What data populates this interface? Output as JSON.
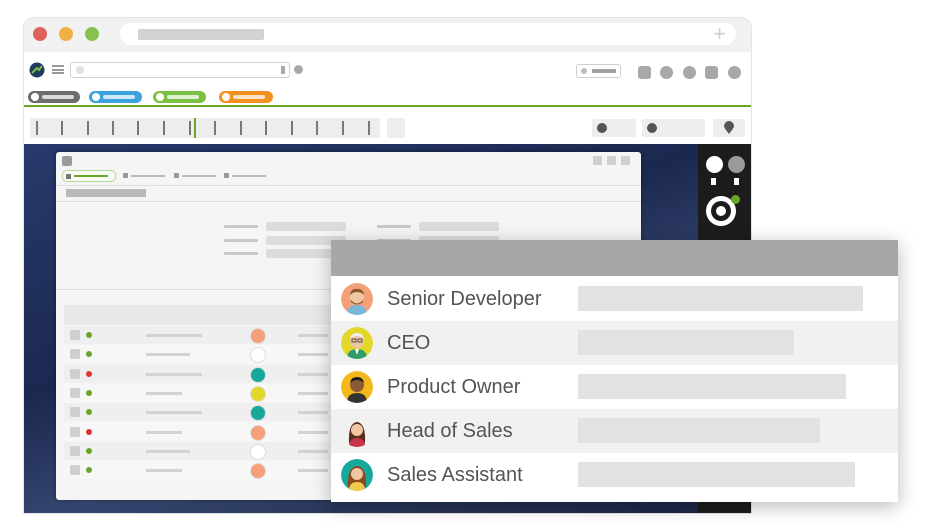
{
  "window": {
    "traffic_lights": [
      {
        "name": "close",
        "color": "#e0615c"
      },
      {
        "name": "minimize",
        "color": "#eeb144"
      },
      {
        "name": "maximize",
        "color": "#87c250"
      }
    ],
    "new_tab_symbol": "+"
  },
  "toolbar": {
    "filter_pills": [
      {
        "color": "#6d6d6d"
      },
      {
        "color": "#3aa2dc"
      },
      {
        "color": "#7ac143"
      },
      {
        "color": "#f5901e"
      }
    ],
    "accent_color": "#6aa626"
  },
  "list": {
    "rows": [
      {
        "status_color": "#6aa626"
      },
      {
        "status_color": "#6aa626"
      },
      {
        "status_color": "#e0322e"
      },
      {
        "status_color": "#6aa626"
      },
      {
        "status_color": "#6aa626"
      },
      {
        "status_color": "#e0322e"
      },
      {
        "status_color": "#6aa626"
      },
      {
        "status_color": "#6aa626"
      }
    ]
  },
  "popup": {
    "roles": [
      {
        "label": "Senior Developer",
        "avatar": "developer-avatar",
        "value_fill": 0.88
      },
      {
        "label": "CEO",
        "avatar": "ceo-avatar",
        "value_fill": 0.66
      },
      {
        "label": "Product Owner",
        "avatar": "product-owner-avatar",
        "value_fill": 0.83
      },
      {
        "label": "Head of Sales",
        "avatar": "head-of-sales-avatar",
        "value_fill": 0.75
      },
      {
        "label": "Sales Assistant",
        "avatar": "sales-assistant-avatar",
        "value_fill": 0.86
      }
    ]
  }
}
